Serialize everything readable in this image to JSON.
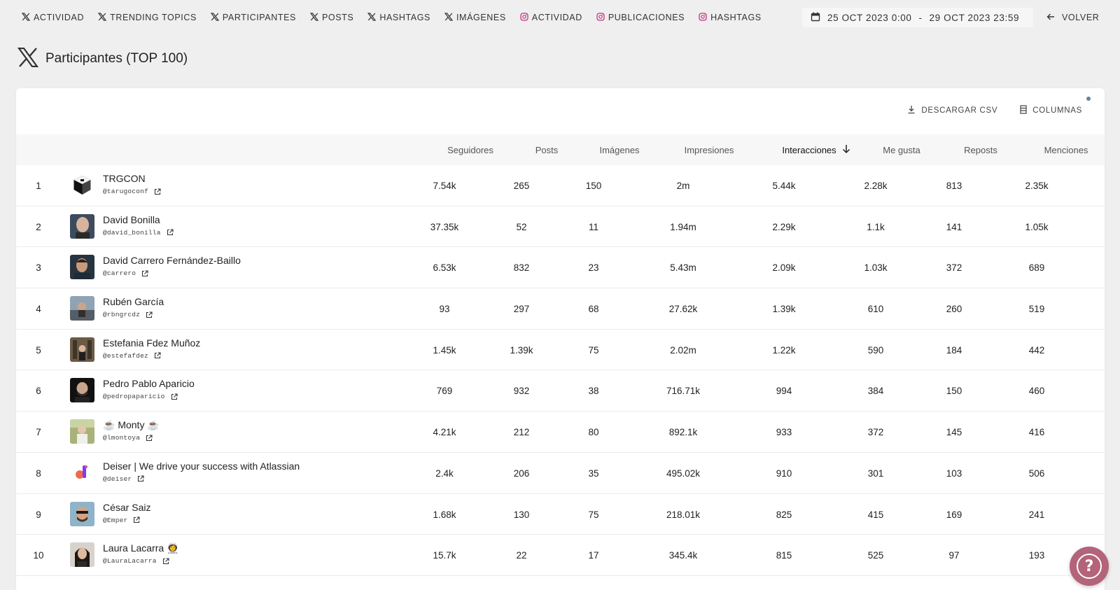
{
  "nav": {
    "items": [
      {
        "platform": "x-icon",
        "label": "ACTIVIDAD"
      },
      {
        "platform": "x-icon",
        "label": "TRENDING TOPICS"
      },
      {
        "platform": "x-icon",
        "label": "PARTICIPANTES"
      },
      {
        "platform": "x-icon",
        "label": "POSTS"
      },
      {
        "platform": "x-icon",
        "label": "HASHTAGS"
      },
      {
        "platform": "x-icon",
        "label": "IMÁGENES"
      },
      {
        "platform": "instagram-icon",
        "label": "ACTIVIDAD"
      },
      {
        "platform": "instagram-icon",
        "label": "PUBLICACIONES"
      },
      {
        "platform": "instagram-icon",
        "label": "HASHTAGS"
      }
    ],
    "date_start": "25 OCT 2023 0:00",
    "date_sep": "-",
    "date_end": "29 OCT 2023 23:59",
    "back_label": "VOLVER"
  },
  "page": {
    "title": "Participantes (TOP 100)"
  },
  "actions": {
    "download_label": "DESCARGAR CSV",
    "columns_label": "COLUMNAS"
  },
  "table": {
    "headers": {
      "followers": "Seguidores",
      "posts": "Posts",
      "images": "Imágenes",
      "impressions": "Impresiones",
      "interactions": "Interacciones",
      "likes": "Me gusta",
      "reposts": "Reposts",
      "mentions": "Menciones"
    },
    "rows": [
      {
        "rank": "1",
        "name": "TRGCON",
        "handle": "@tarugoconf",
        "followers": "7.54k",
        "posts": "265",
        "images": "150",
        "impressions": "2m",
        "interactions": "5.44k",
        "likes": "2.28k",
        "reposts": "813",
        "mentions": "2.35k"
      },
      {
        "rank": "2",
        "name": "David Bonilla",
        "handle": "@david_bonilla",
        "followers": "37.35k",
        "posts": "52",
        "images": "11",
        "impressions": "1.94m",
        "interactions": "2.29k",
        "likes": "1.1k",
        "reposts": "141",
        "mentions": "1.05k"
      },
      {
        "rank": "3",
        "name": "David Carrero Fernández-Baillo",
        "handle": "@carrero",
        "followers": "6.53k",
        "posts": "832",
        "images": "23",
        "impressions": "5.43m",
        "interactions": "2.09k",
        "likes": "1.03k",
        "reposts": "372",
        "mentions": "689"
      },
      {
        "rank": "4",
        "name": "Rubén García",
        "handle": "@rbngrcdz",
        "followers": "93",
        "posts": "297",
        "images": "68",
        "impressions": "27.62k",
        "interactions": "1.39k",
        "likes": "610",
        "reposts": "260",
        "mentions": "519"
      },
      {
        "rank": "5",
        "name": "Estefania Fdez Muñoz",
        "handle": "@estefafdez",
        "followers": "1.45k",
        "posts": "1.39k",
        "images": "75",
        "impressions": "2.02m",
        "interactions": "1.22k",
        "likes": "590",
        "reposts": "184",
        "mentions": "442"
      },
      {
        "rank": "6",
        "name": "Pedro Pablo Aparicio",
        "handle": "@pedropaparicio",
        "followers": "769",
        "posts": "932",
        "images": "38",
        "impressions": "716.71k",
        "interactions": "994",
        "likes": "384",
        "reposts": "150",
        "mentions": "460"
      },
      {
        "rank": "7",
        "name": "☕ Monty ☕",
        "handle": "@lmontoya",
        "followers": "4.21k",
        "posts": "212",
        "images": "80",
        "impressions": "892.1k",
        "interactions": "933",
        "likes": "372",
        "reposts": "145",
        "mentions": "416"
      },
      {
        "rank": "8",
        "name": "Deiser | We drive your success with Atlassian",
        "handle": "@deiser",
        "followers": "2.4k",
        "posts": "206",
        "images": "35",
        "impressions": "495.02k",
        "interactions": "910",
        "likes": "301",
        "reposts": "103",
        "mentions": "506"
      },
      {
        "rank": "9",
        "name": "César Saiz",
        "handle": "@Emper",
        "followers": "1.68k",
        "posts": "130",
        "images": "75",
        "impressions": "218.01k",
        "interactions": "825",
        "likes": "415",
        "reposts": "169",
        "mentions": "241"
      },
      {
        "rank": "10",
        "name": "Laura Lacarra 👩‍🚀",
        "handle": "@LauraLacarra",
        "followers": "15.7k",
        "posts": "22",
        "images": "17",
        "impressions": "345.4k",
        "interactions": "815",
        "likes": "525",
        "reposts": "97",
        "mentions": "193"
      }
    ]
  },
  "help": {
    "label": "?"
  },
  "colors": {
    "background": "#efefef",
    "card": "#ffffff",
    "help": "#b3637a",
    "instagram": "#c13584",
    "badge": "#5f86a3"
  }
}
